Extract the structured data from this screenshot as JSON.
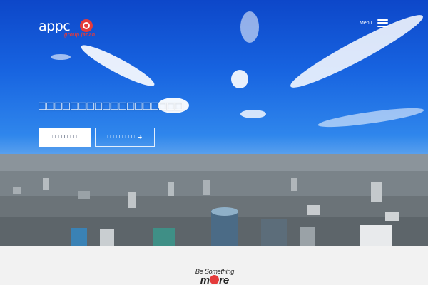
{
  "header": {
    "logo_text": "appc",
    "logo_sub": "group japan",
    "menu_label": "Menu"
  },
  "hero": {
    "title": "□□□□□□□□□□□□□□□□□□",
    "primary_button": "□□□□□□□□",
    "secondary_button": "□□□□□□□□□"
  },
  "tagline": {
    "line1": "Be Something",
    "line2_prefix": "m",
    "line2_suffix": "re"
  },
  "colors": {
    "brand_red": "#e43b3b",
    "sky_blue": "#1763e0",
    "page_bg": "#f2f2f2"
  }
}
